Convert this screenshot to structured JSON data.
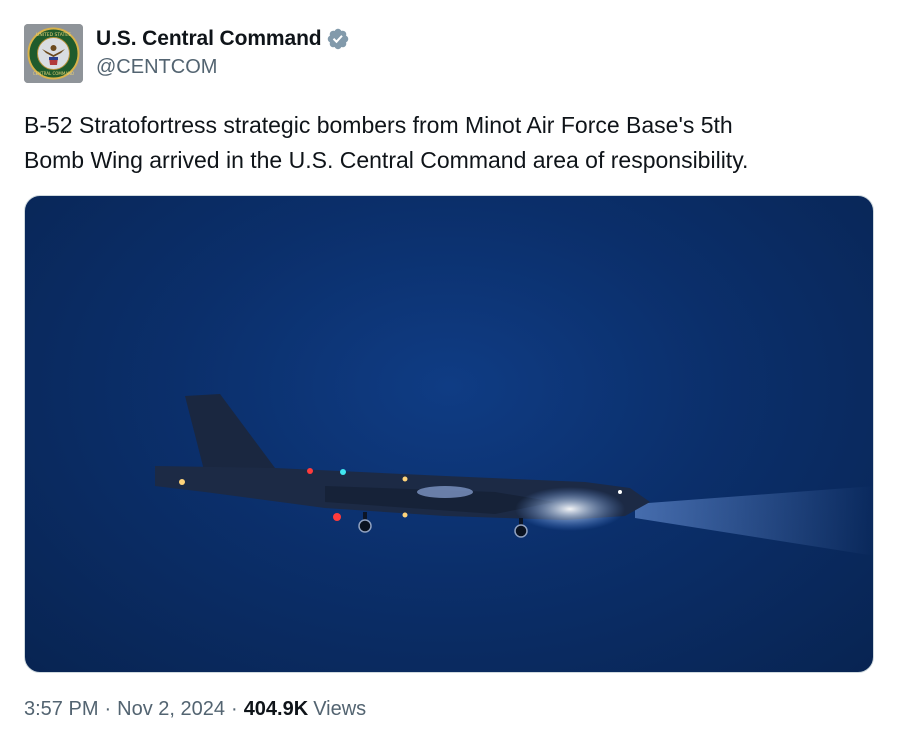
{
  "account": {
    "display_name": "U.S. Central Command",
    "handle": "@CENTCOM",
    "avatar_icon": "centcom-seal-icon",
    "verified_icon": "verified-badge-icon",
    "avatar_seal_text_top": "UNITED STATES",
    "avatar_seal_text_bottom": "CENTRAL COMMAND"
  },
  "tweet": {
    "text_line1": "B-52 Stratofortress strategic bombers from Minot Air Force Base's 5th",
    "text_line2": "Bomb Wing arrived in the U.S. Central Command area of responsibility."
  },
  "media": {
    "subject": "b52-bomber-night-photo"
  },
  "meta": {
    "time": "3:57 PM",
    "separator": "·",
    "date": "Nov 2, 2024",
    "views_count": "404.9K",
    "views_label": "Views"
  },
  "colors": {
    "text_primary": "#0f1419",
    "text_secondary": "#536471",
    "verified_badge": "#829aab",
    "night_sky": "#0b2f6b"
  }
}
